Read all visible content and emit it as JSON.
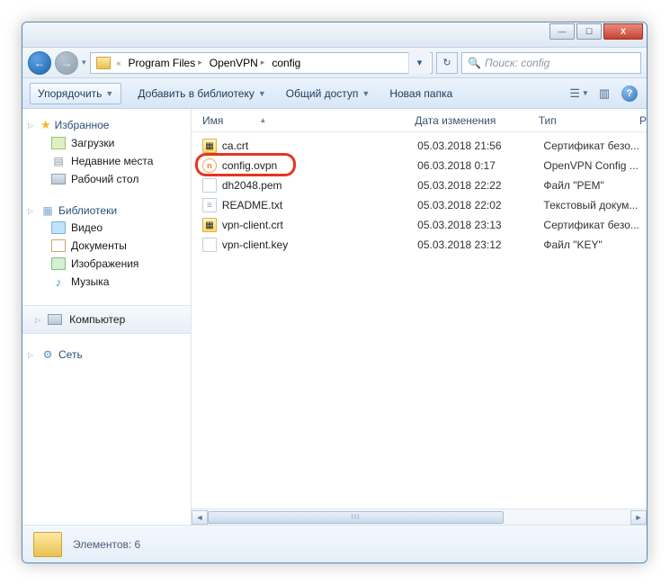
{
  "window_controls": {
    "min": "—",
    "max": "☐",
    "close": "X"
  },
  "breadcrumb": {
    "root_chev": "«",
    "seg1": "Program Files",
    "seg2": "OpenVPN",
    "seg3": "config"
  },
  "nav": {
    "back": "←",
    "fwd": "→",
    "history_chev": "▾",
    "refresh": "↻"
  },
  "search": {
    "placeholder": "Поиск: config",
    "icon": "🔍"
  },
  "toolbar": {
    "organize": "Упорядочить",
    "add_library": "Добавить в библиотеку",
    "share": "Общий доступ",
    "new_folder": "Новая папка"
  },
  "sidebar": {
    "favorites": "Избранное",
    "downloads": "Загрузки",
    "recent": "Недавние места",
    "desktop": "Рабочий стол",
    "libraries": "Библиотеки",
    "video": "Видео",
    "documents": "Документы",
    "pictures": "Изображения",
    "music": "Музыка",
    "computer": "Компьютер",
    "network": "Сеть"
  },
  "columns": {
    "name": "Имя",
    "date": "Дата изменения",
    "type": "Тип",
    "size": "Р"
  },
  "files": [
    {
      "name": "ca.crt",
      "date": "05.03.2018 21:56",
      "type": "Сертификат безо...",
      "icon": "crt"
    },
    {
      "name": "config.ovpn",
      "date": "06.03.2018 0:17",
      "type": "OpenVPN Config ...",
      "icon": "ovpn",
      "highlighted": true
    },
    {
      "name": "dh2048.pem",
      "date": "05.03.2018 22:22",
      "type": "Файл \"PEM\"",
      "icon": "pem"
    },
    {
      "name": "README.txt",
      "date": "05.03.2018 22:02",
      "type": "Текстовый докум...",
      "icon": "txt"
    },
    {
      "name": "vpn-client.crt",
      "date": "05.03.2018 23:13",
      "type": "Сертификат безо...",
      "icon": "crt"
    },
    {
      "name": "vpn-client.key",
      "date": "05.03.2018 23:12",
      "type": "Файл \"KEY\"",
      "icon": "key"
    }
  ],
  "status": {
    "items_label": "Элементов: 6"
  }
}
